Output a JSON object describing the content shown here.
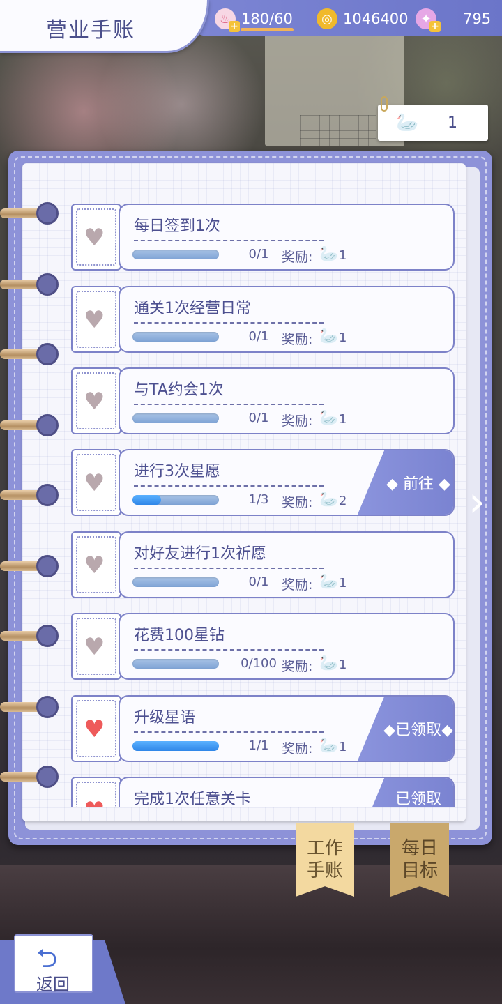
{
  "header": {
    "title": "营业手账"
  },
  "resources": {
    "stamina": {
      "icon": "cake-icon",
      "value": "180/60"
    },
    "gold": {
      "icon": "coin-icon",
      "value": "1046400"
    },
    "diamond": {
      "icon": "crystal-icon",
      "value": "795"
    }
  },
  "swan_counter": {
    "icon": "swan-icon",
    "value": "1"
  },
  "tasks": [
    {
      "name": "每日签到1次",
      "progress": "0/1",
      "progress_fraction": 0,
      "reward_label": "奖励:",
      "reward_count": "1",
      "heart": "grey",
      "action": ""
    },
    {
      "name": "通关1次经营日常",
      "progress": "0/1",
      "progress_fraction": 0,
      "reward_label": "奖励:",
      "reward_count": "1",
      "heart": "grey",
      "action": ""
    },
    {
      "name": "与TA约会1次",
      "progress": "0/1",
      "progress_fraction": 0,
      "reward_label": "奖励:",
      "reward_count": "1",
      "heart": "grey",
      "action": ""
    },
    {
      "name": "进行3次星愿",
      "progress": "1/3",
      "progress_fraction": 0.333,
      "reward_label": "奖励:",
      "reward_count": "2",
      "heart": "grey",
      "action": "◆ 前往 ◆"
    },
    {
      "name": "对好友进行1次祈愿",
      "progress": "0/1",
      "progress_fraction": 0,
      "reward_label": "奖励:",
      "reward_count": "1",
      "heart": "grey",
      "action": ""
    },
    {
      "name": "花费100星钻",
      "progress": "0/100",
      "progress_fraction": 0,
      "reward_label": "奖励:",
      "reward_count": "1",
      "heart": "grey",
      "action": ""
    },
    {
      "name": "升级星语",
      "progress": "1/1",
      "progress_fraction": 1,
      "reward_label": "奖励:",
      "reward_count": "1",
      "heart": "red",
      "action": "◆已领取◆"
    },
    {
      "name": "完成1次任意关卡",
      "progress": "",
      "progress_fraction": 0,
      "reward_label": "",
      "reward_count": "",
      "heart": "red",
      "action": "已领取"
    }
  ],
  "tabs": [
    {
      "label": "工作手账",
      "active": true
    },
    {
      "label": "每日目标",
      "active": false
    }
  ],
  "back_button": {
    "label": "返回"
  }
}
